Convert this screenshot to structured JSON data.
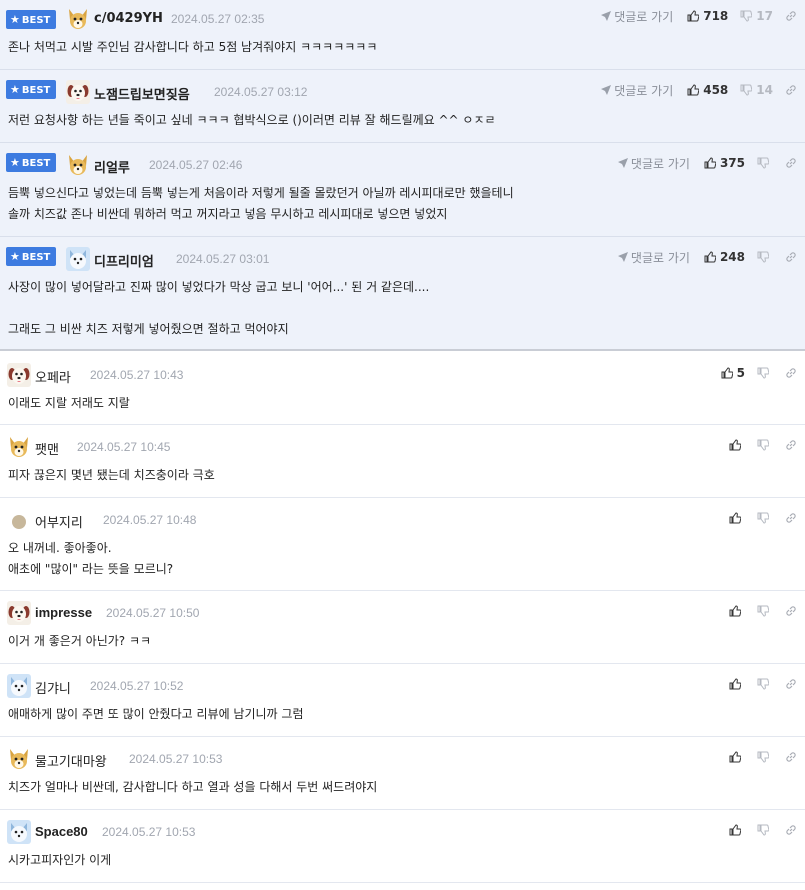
{
  "labels": {
    "best": "BEST",
    "reply": "댓글로 가기"
  },
  "colors": {
    "best_bg": "#3d7be0",
    "best_row_bg": "#eef2fa",
    "muted": "#a1a6b0"
  },
  "best_comments": [
    {
      "avatar": "dog-avatar",
      "nick": "c/0429YH",
      "date": "2024.05.27 02:35",
      "up": "718",
      "down": "17",
      "lines": [
        "존나 처먹고 시발 주인님 감사합니다 하고 5점 남겨줘야지 ㅋㅋㅋㅋㅋㅋㅋ"
      ]
    },
    {
      "avatar": "puppy-avatar",
      "nick": "노잼드립보면짖음",
      "date": "2024.05.27 03:12",
      "up": "458",
      "down": "14",
      "lines": [
        "저런 요청사항 하는 년들 죽이고 싶네 ㅋㅋㅋ 협박식으로 ()이러면 리뷰 잘 해드릴께요 ^^ ㅇㅈㄹ"
      ]
    },
    {
      "avatar": "dog-avatar",
      "nick": "리얼루",
      "date": "2024.05.27 02:46",
      "up": "375",
      "down": "",
      "lines": [
        "듬뿍 넣으신다고 넣었는데 듬뿍 넣는게 처음이라 저렇게 될줄 몰랐던거 아닐까 레시피대로만 했을테니",
        "솔까 치즈값 존나 비싼데 뭐하러 먹고 꺼지라고 넣음 무시하고 레시피대로 넣으면 넣었지"
      ]
    },
    {
      "avatar": "white-dog-avatar",
      "nick": "디프리미엄",
      "date": "2024.05.27 03:01",
      "up": "248",
      "down": "",
      "lines": [
        "사장이 많이 넣어달라고 진짜 많이 넣었다가 막상 굽고 보니 '어어...' 된 거 같은데....",
        "",
        "그래도 그 비싼 치즈 저렇게 넣어줬으면 절하고 먹어야지"
      ]
    }
  ],
  "comments": [
    {
      "avatar": "puppy-avatar",
      "nick": "오페라",
      "date": "2024.05.27 10:43",
      "up": "5",
      "lines": [
        "이래도 지랄 저래도 지랄"
      ]
    },
    {
      "avatar": "dog-avatar",
      "nick": "팻맨",
      "date": "2024.05.27 10:45",
      "up": "",
      "lines": [
        "피자 끊은지 몇년 됐는데 치즈충이라 극호"
      ]
    },
    {
      "avatar": "circle-avatar",
      "nick": "어부지리",
      "date": "2024.05.27 10:48",
      "up": "",
      "lines": [
        "오 내꺼네. 좋아좋아.",
        "애초에 \"많이\" 라는 뜻을 모르니?"
      ]
    },
    {
      "avatar": "puppy-avatar",
      "nick": "impresse",
      "date": "2024.05.27 10:50",
      "up": "",
      "lines": [
        "이거 개 좋은거 아닌가? ㅋㅋ"
      ]
    },
    {
      "avatar": "white-dog-avatar",
      "nick": "김갸니",
      "date": "2024.05.27 10:52",
      "up": "",
      "lines": [
        "애매하게 많이 주면 또 많이 안줬다고 리뷰에 남기니까 그럼"
      ]
    },
    {
      "avatar": "dog-avatar",
      "nick": "물고기대마왕",
      "date": "2024.05.27 10:53",
      "up": "",
      "lines": [
        "치즈가 얼마나 비싼데, 감사합니다 하고 열과 성을 다해서 두번 써드려야지"
      ]
    },
    {
      "avatar": "white-dog-avatar",
      "nick": "Space80",
      "date": "2024.05.27 10:53",
      "up": "",
      "lines": [
        "시카고피자인가 이게"
      ]
    }
  ]
}
